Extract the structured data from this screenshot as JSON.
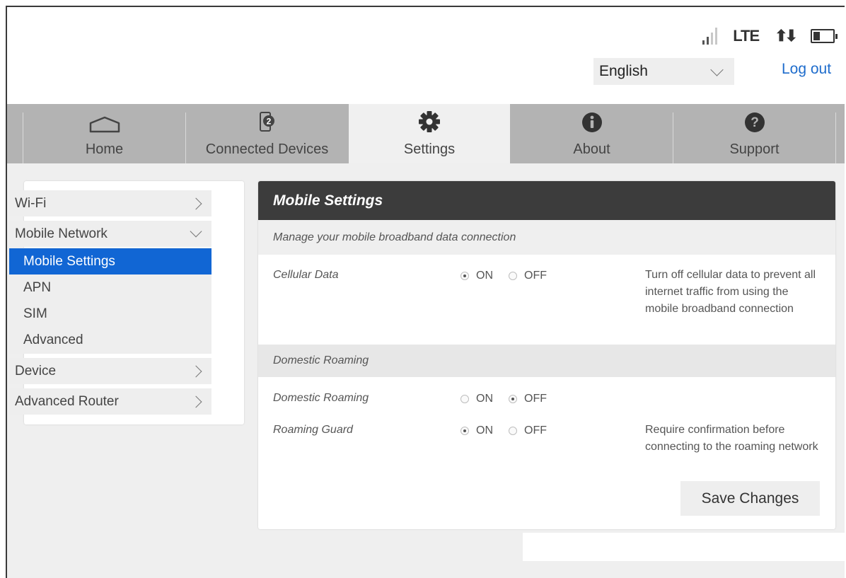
{
  "header": {
    "status": {
      "signal_icon": "signal-strength-icon",
      "signal_bars_active": 2,
      "signal_bars_total": 4,
      "network_type": "LTE",
      "data_icon": "up-down-arrows-icon",
      "data_arrows": "⬆⬇",
      "battery_icon": "battery-icon",
      "battery_level": 0.3
    },
    "language": {
      "selected": "English"
    },
    "logout_label": "Log out"
  },
  "nav": {
    "tabs": [
      {
        "label": "Home",
        "icon": "home-icon"
      },
      {
        "label": "Connected Devices",
        "icon": "connected-devices-icon",
        "badge": "2"
      },
      {
        "label": "Settings",
        "icon": "gear-icon",
        "active": true
      },
      {
        "label": "About",
        "icon": "info-icon"
      },
      {
        "label": "Support",
        "icon": "question-icon"
      }
    ]
  },
  "sidebar": {
    "wifi": "Wi-Fi",
    "mobile_network": "Mobile Network",
    "sub_items": [
      "Mobile Settings",
      "APN",
      "SIM",
      "Advanced"
    ],
    "device": "Device",
    "advanced_router": "Advanced Router"
  },
  "panel": {
    "title": "Mobile Settings",
    "subtitle": "Manage your mobile broadband data connection",
    "on_label": "ON",
    "off_label": "OFF",
    "cellular_data": {
      "label": "Cellular Data",
      "value": "ON",
      "description": "Turn off cellular data to prevent all internet traffic from using the mobile broadband connection"
    },
    "roaming_section": "Domestic Roaming",
    "domestic_roaming": {
      "label": "Domestic Roaming",
      "value": "OFF"
    },
    "roaming_guard": {
      "label": "Roaming Guard",
      "value": "ON",
      "description": "Require confirmation before connecting to the roaming network"
    },
    "save_label": "Save Changes"
  },
  "colors": {
    "accent": "#1166d4",
    "nav_bg": "#b3b3b3",
    "panel_header": "#3c3c3c",
    "link": "#1e6ccc"
  }
}
